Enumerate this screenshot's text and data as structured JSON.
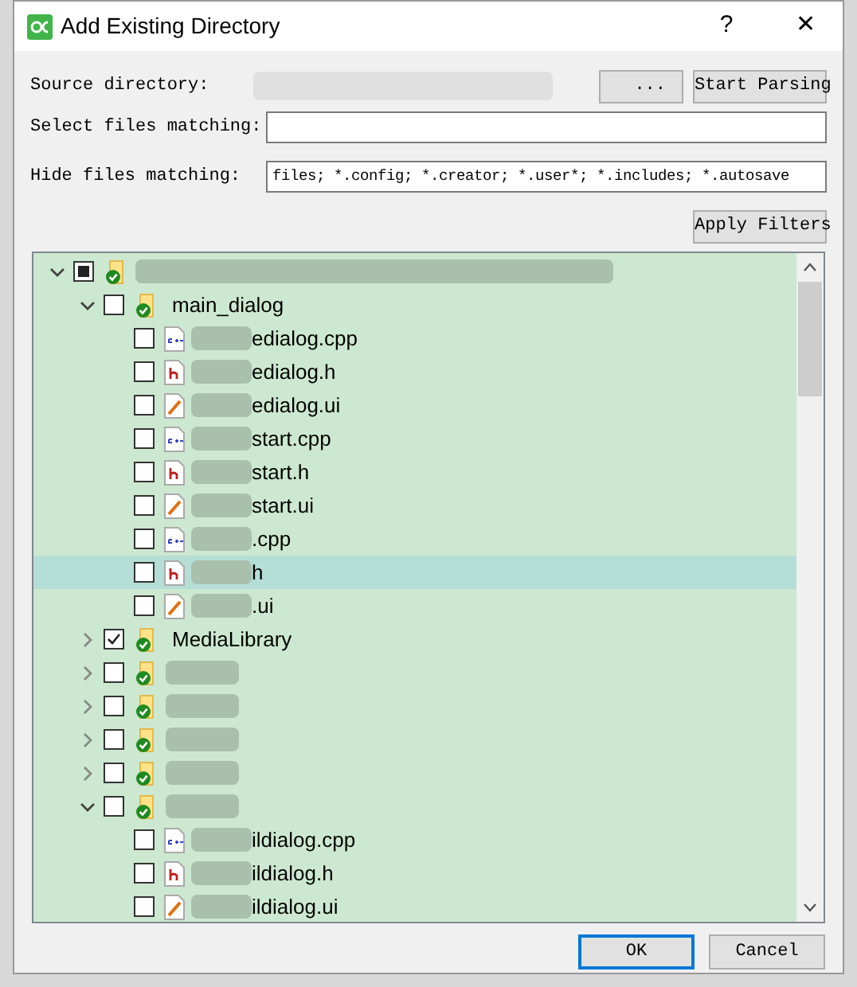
{
  "window": {
    "title": "Add Existing Directory",
    "help": "?",
    "close": "✕"
  },
  "form": {
    "source_label": "Source directory:",
    "browse_button": "...",
    "parse_button": "Start Parsing",
    "select_label": "Select files matching:",
    "hide_label": "Hide files matching:",
    "hide_value": "files; *.config; *.creator; *.user*; *.includes; *.autosave",
    "apply_button": "Apply Filters"
  },
  "tree": [
    {
      "kind": "folder",
      "redacted": true,
      "checked": false,
      "mixed": true,
      "expanded": true,
      "selected": false,
      "children": [
        {
          "kind": "folder",
          "label": "main_dialog",
          "checked": false,
          "mixed": false,
          "expanded": true,
          "selected": false,
          "children": [
            {
              "kind": "cpp",
              "redacted": true,
              "label": "edialog.cpp",
              "checked": false,
              "mixed": false,
              "selected": false
            },
            {
              "kind": "h",
              "redacted": true,
              "label": "edialog.h",
              "checked": false,
              "mixed": false,
              "selected": false
            },
            {
              "kind": "ui",
              "redacted": true,
              "label": "edialog.ui",
              "checked": false,
              "mixed": false,
              "selected": false
            },
            {
              "kind": "cpp",
              "redacted": true,
              "label": "start.cpp",
              "checked": false,
              "mixed": false,
              "selected": false
            },
            {
              "kind": "h",
              "redacted": true,
              "label": "start.h",
              "checked": false,
              "mixed": false,
              "selected": false
            },
            {
              "kind": "ui",
              "redacted": true,
              "label": "start.ui",
              "checked": false,
              "mixed": false,
              "selected": false
            },
            {
              "kind": "cpp",
              "redacted": true,
              "label": ".cpp",
              "checked": false,
              "mixed": false,
              "selected": false
            },
            {
              "kind": "h",
              "redacted": true,
              "label": "h",
              "checked": false,
              "mixed": false,
              "selected": true
            },
            {
              "kind": "ui",
              "redacted": true,
              "label": ".ui",
              "checked": false,
              "mixed": false,
              "selected": false
            }
          ]
        },
        {
          "kind": "folder",
          "label": "MediaLibrary",
          "checked": true,
          "mixed": false,
          "expanded": false,
          "selected": false
        },
        {
          "kind": "folder",
          "redacted": true,
          "checked": false,
          "mixed": false,
          "expanded": false,
          "selected": false
        },
        {
          "kind": "folder",
          "redacted": true,
          "checked": false,
          "mixed": false,
          "expanded": false,
          "selected": false
        },
        {
          "kind": "folder",
          "redacted": true,
          "checked": false,
          "mixed": false,
          "expanded": false,
          "selected": false
        },
        {
          "kind": "folder",
          "redacted": true,
          "checked": false,
          "mixed": false,
          "expanded": false,
          "selected": false
        },
        {
          "kind": "folder",
          "redacted": true,
          "checked": false,
          "mixed": false,
          "expanded": true,
          "selected": false,
          "children": [
            {
              "kind": "cpp",
              "redacted": true,
              "label": "ildialog.cpp",
              "checked": false,
              "mixed": false,
              "selected": false
            },
            {
              "kind": "h",
              "redacted": true,
              "label": "ildialog.h",
              "checked": false,
              "mixed": false,
              "selected": false
            },
            {
              "kind": "ui",
              "redacted": true,
              "label": "ildialog.ui",
              "checked": false,
              "mixed": false,
              "selected": false
            }
          ]
        }
      ]
    }
  ],
  "buttons": {
    "ok": "OK",
    "cancel": "Cancel"
  }
}
